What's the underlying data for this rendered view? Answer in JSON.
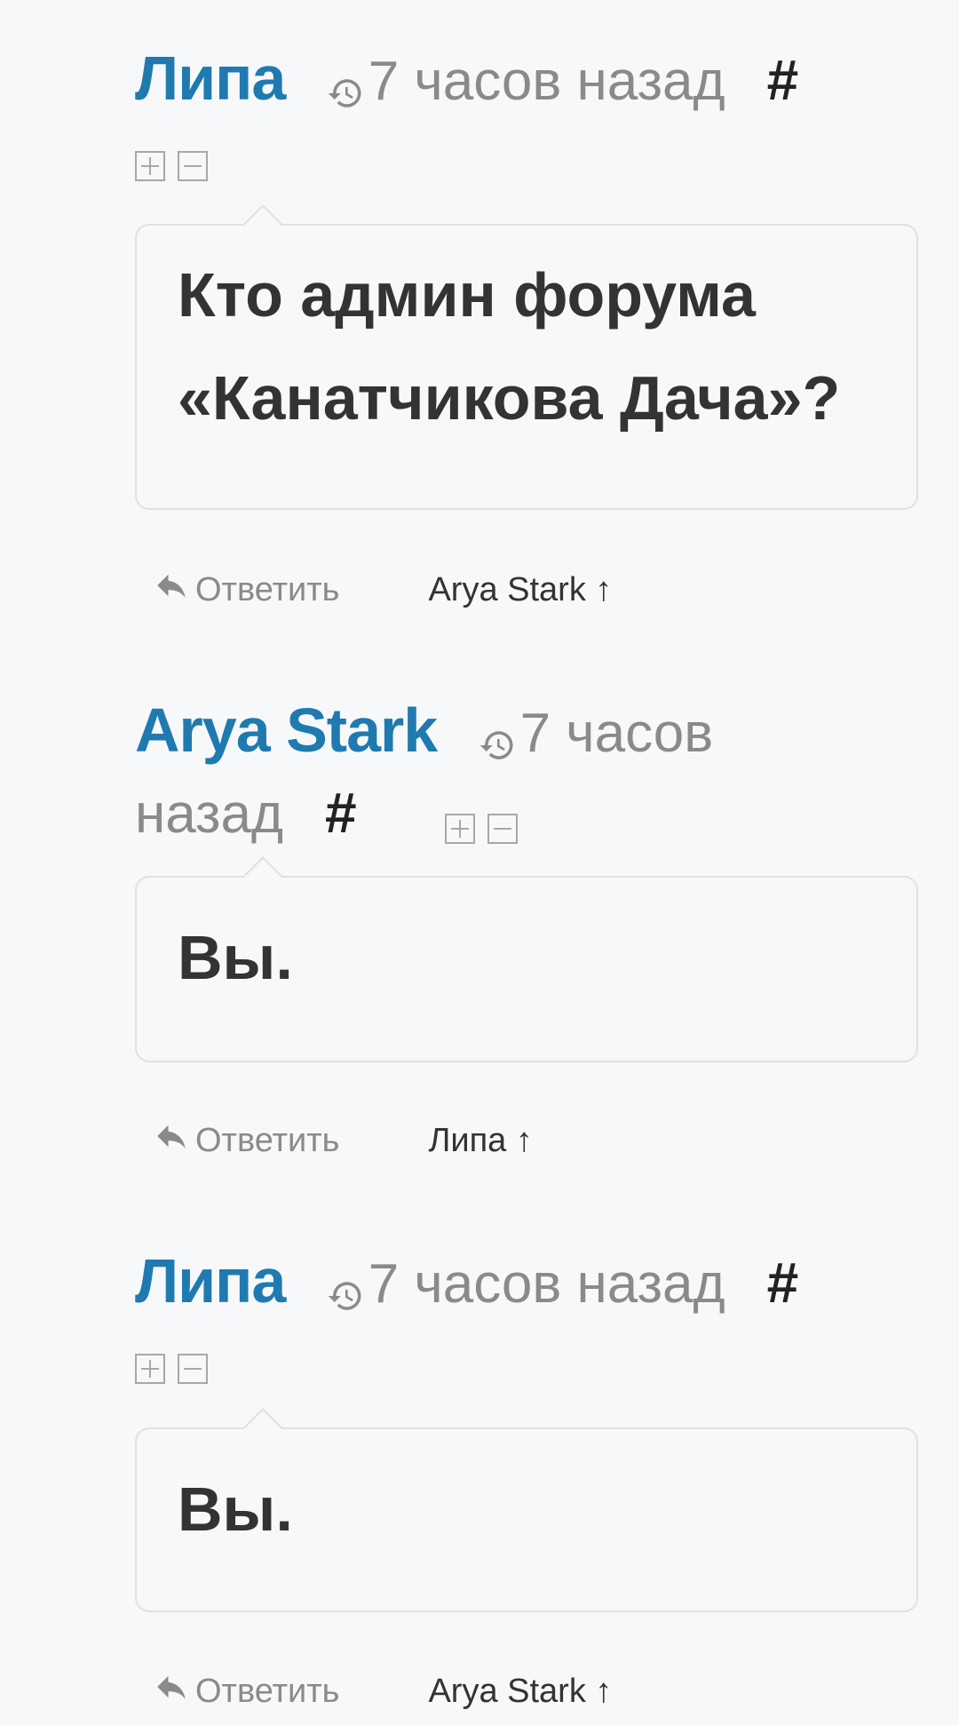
{
  "comments": [
    {
      "author": "Липа",
      "time": "7 часов назад",
      "hash": "#",
      "text_line1": "Кто админ форума",
      "text_line2": "«Канатчикова Дача»?",
      "reply_label": "Ответить",
      "parent_link": "Arya Stark ↑"
    },
    {
      "author": "Arya Stark",
      "time_part1": "7 часов",
      "time_part2": "назад",
      "hash": "#",
      "text_line1": "Вы.",
      "reply_label": "Ответить",
      "parent_link": "Липа ↑"
    },
    {
      "author": "Липа",
      "time": "7 часов назад",
      "hash": "#",
      "text_line1": "Вы.",
      "reply_label": "Ответить",
      "parent_link": "Arya Stark ↑"
    }
  ],
  "colors": {
    "author": "#1f7ab0",
    "muted": "#8a8a8a",
    "text": "#333333",
    "background": "#f7f8fa"
  },
  "icons": [
    "history-icon",
    "expand-icon",
    "collapse-icon",
    "reply-icon"
  ]
}
